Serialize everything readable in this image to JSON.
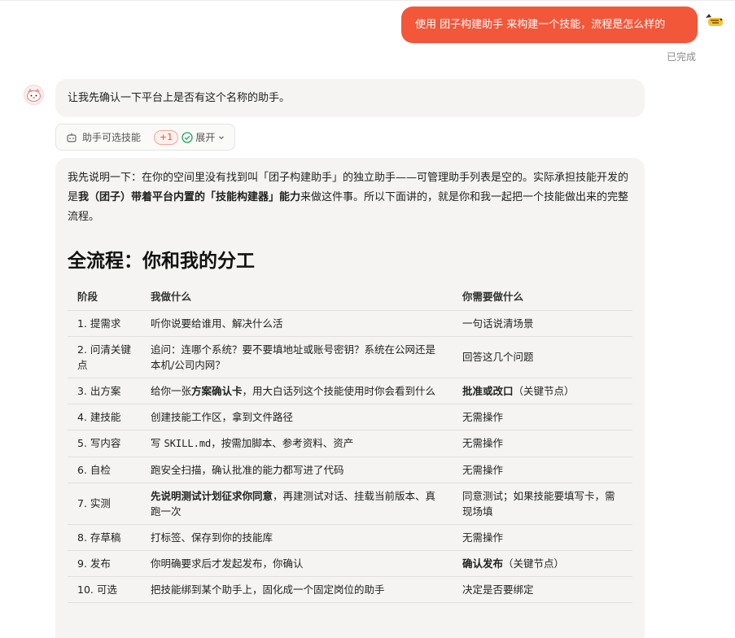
{
  "user_message": {
    "text": "使用 团子构建助手 来构建一个技能，流程是怎么样的",
    "status": "已完成"
  },
  "assistant": {
    "first_reply": "让我先确认一下平台上是否有这个名称的助手。",
    "skill_chip": {
      "label": "助手可选技能",
      "badge": "+1",
      "expand": "展开"
    },
    "intro": {
      "p1": "我先说明一下：在你的空间里没有找到叫「团子构建助手」的独立助手——可管理助手列表是空的。实际承担技能开发的是",
      "p1_bold": "我（团子）带着平台内置的「技能构建器」能力",
      "p1_end": "来做这件事。所以下面讲的，就是你和我一起把一个技能做出来的完整流程。"
    },
    "heading": "全流程：你和我的分工",
    "table": {
      "headers": [
        "阶段",
        "我做什么",
        "你需要做什么"
      ],
      "rows": [
        {
          "stage": "1. 提需求",
          "me": "听你说要给谁用、解决什么活",
          "you": "一句话说清场景"
        },
        {
          "stage": "2. 问清关键点",
          "me": "追问：连哪个系统？要不要填地址或账号密钥？系统在公网还是本机/公司内网？",
          "you": "回答这几个问题"
        },
        {
          "stage": "3. 出方案",
          "me_pre": "给你一张",
          "me_bold": "方案确认卡",
          "me_post": "，用大白话列这个技能使用时你会看到什么",
          "you_bold": "批准或改口",
          "you_post": "（关键节点）"
        },
        {
          "stage": "4. 建技能",
          "me": "创建技能工作区，拿到文件路径",
          "you": "无需操作"
        },
        {
          "stage": "5. 写内容",
          "me_pre": "写 ",
          "me_code": "SKILL.md",
          "me_post": "，按需加脚本、参考资料、资产",
          "you": "无需操作"
        },
        {
          "stage": "6. 自检",
          "me": "跑安全扫描，确认批准的能力都写进了代码",
          "you": "无需操作"
        },
        {
          "stage": "7. 实测",
          "me_bold": "先说明测试计划征求你同意",
          "me_post": "，再建测试对话、挂载当前版本、真跑一次",
          "you": "同意测试；如果技能要填写卡，需现场填"
        },
        {
          "stage": "8. 存草稿",
          "me": "打标签、保存到你的技能库",
          "you": "无需操作"
        },
        {
          "stage": "9. 发布",
          "me": "你明确要求后才发起发布，你确认",
          "you_bold": "确认发布",
          "you_post": "（关键节点）"
        },
        {
          "stage": "10. 可选",
          "me": "把技能绑到某个助手上，固化成一个固定岗位的助手",
          "you": "决定是否要绑定"
        }
      ]
    }
  },
  "colors": {
    "accent": "#f2573a",
    "bubble_bg": "#f5f4f2",
    "check_green": "#1aaa55"
  }
}
